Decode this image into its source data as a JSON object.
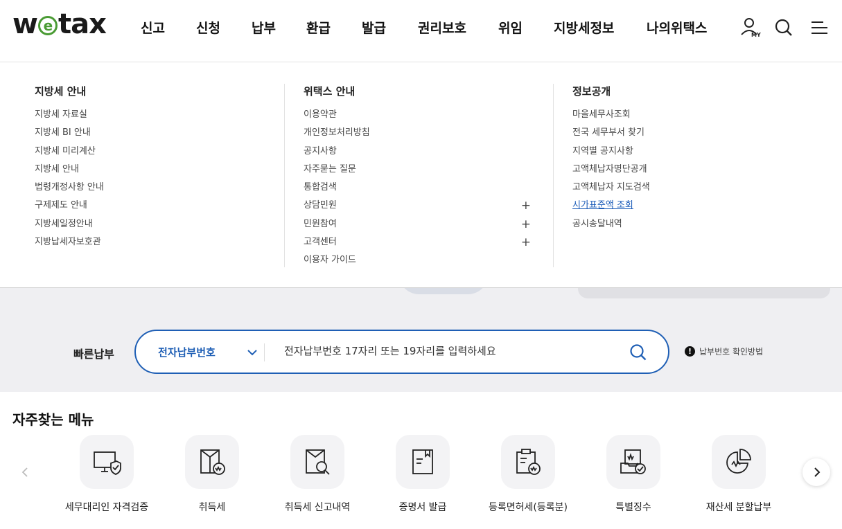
{
  "logo": {
    "left": "w",
    "e": "e",
    "right": "tax"
  },
  "gnb": [
    "신고",
    "신청",
    "납부",
    "환급",
    "발급",
    "권리보호",
    "위임",
    "지방세정보",
    "나의위택스"
  ],
  "header_icons": {
    "my_label": "MY"
  },
  "mega_menu": [
    {
      "title": "지방세 안내",
      "items": [
        {
          "label": "지방세 자료실"
        },
        {
          "label": "지방세 BI 안내"
        },
        {
          "label": "지방세 미리계산"
        },
        {
          "label": "지방세 안내"
        },
        {
          "label": "법령개정사항 안내"
        },
        {
          "label": "구제제도 안내"
        },
        {
          "label": "지방세일정안내"
        },
        {
          "label": "지방납세자보호관"
        }
      ]
    },
    {
      "title": "위택스 안내",
      "items": [
        {
          "label": "이용약관"
        },
        {
          "label": "개인정보처리방침"
        },
        {
          "label": "공지사항"
        },
        {
          "label": "자주묻는 질문"
        },
        {
          "label": "통합검색"
        },
        {
          "label": "상담민원",
          "expand": "+"
        },
        {
          "label": "민원참여",
          "expand": "+"
        },
        {
          "label": "고객센터",
          "expand": "+"
        },
        {
          "label": "이용자 가이드"
        }
      ]
    },
    {
      "title": "정보공개",
      "items": [
        {
          "label": "마을세무사조회"
        },
        {
          "label": "전국 세무부서 찾기"
        },
        {
          "label": "지역별 공지사항"
        },
        {
          "label": "고액체납자명단공개"
        },
        {
          "label": "고액체납자 지도검색"
        },
        {
          "label": "시가표준액 조회",
          "active": true
        },
        {
          "label": "공시송달내역"
        }
      ]
    }
  ],
  "quick_pay": {
    "label": "빠른납부",
    "select_value": "전자납부번호",
    "placeholder": "전자납부번호 17자리 또는 19자리를 입력하세요",
    "help_badge": "!",
    "help_text": "납부번호 확인방법"
  },
  "frequent_menu": {
    "title": "자주찾는 메뉴",
    "items": [
      {
        "label": "세무대리인 자격검증",
        "icon": "monitor-shield-icon"
      },
      {
        "label": "취득세",
        "icon": "document-coin-icon"
      },
      {
        "label": "취득세 신고내역",
        "icon": "document-search-icon"
      },
      {
        "label": "증명서 발급",
        "icon": "certificate-icon"
      },
      {
        "label": "등록면허세(등록분)",
        "icon": "clipboard-coin-icon"
      },
      {
        "label": "특별징수",
        "icon": "tray-check-icon"
      },
      {
        "label": "재산세 분할납부",
        "icon": "pie-chart-icon"
      }
    ]
  },
  "colors": {
    "brand_green": "#4a9b34",
    "accent_blue": "#1f5fb5",
    "band_gray": "#efeff2"
  }
}
